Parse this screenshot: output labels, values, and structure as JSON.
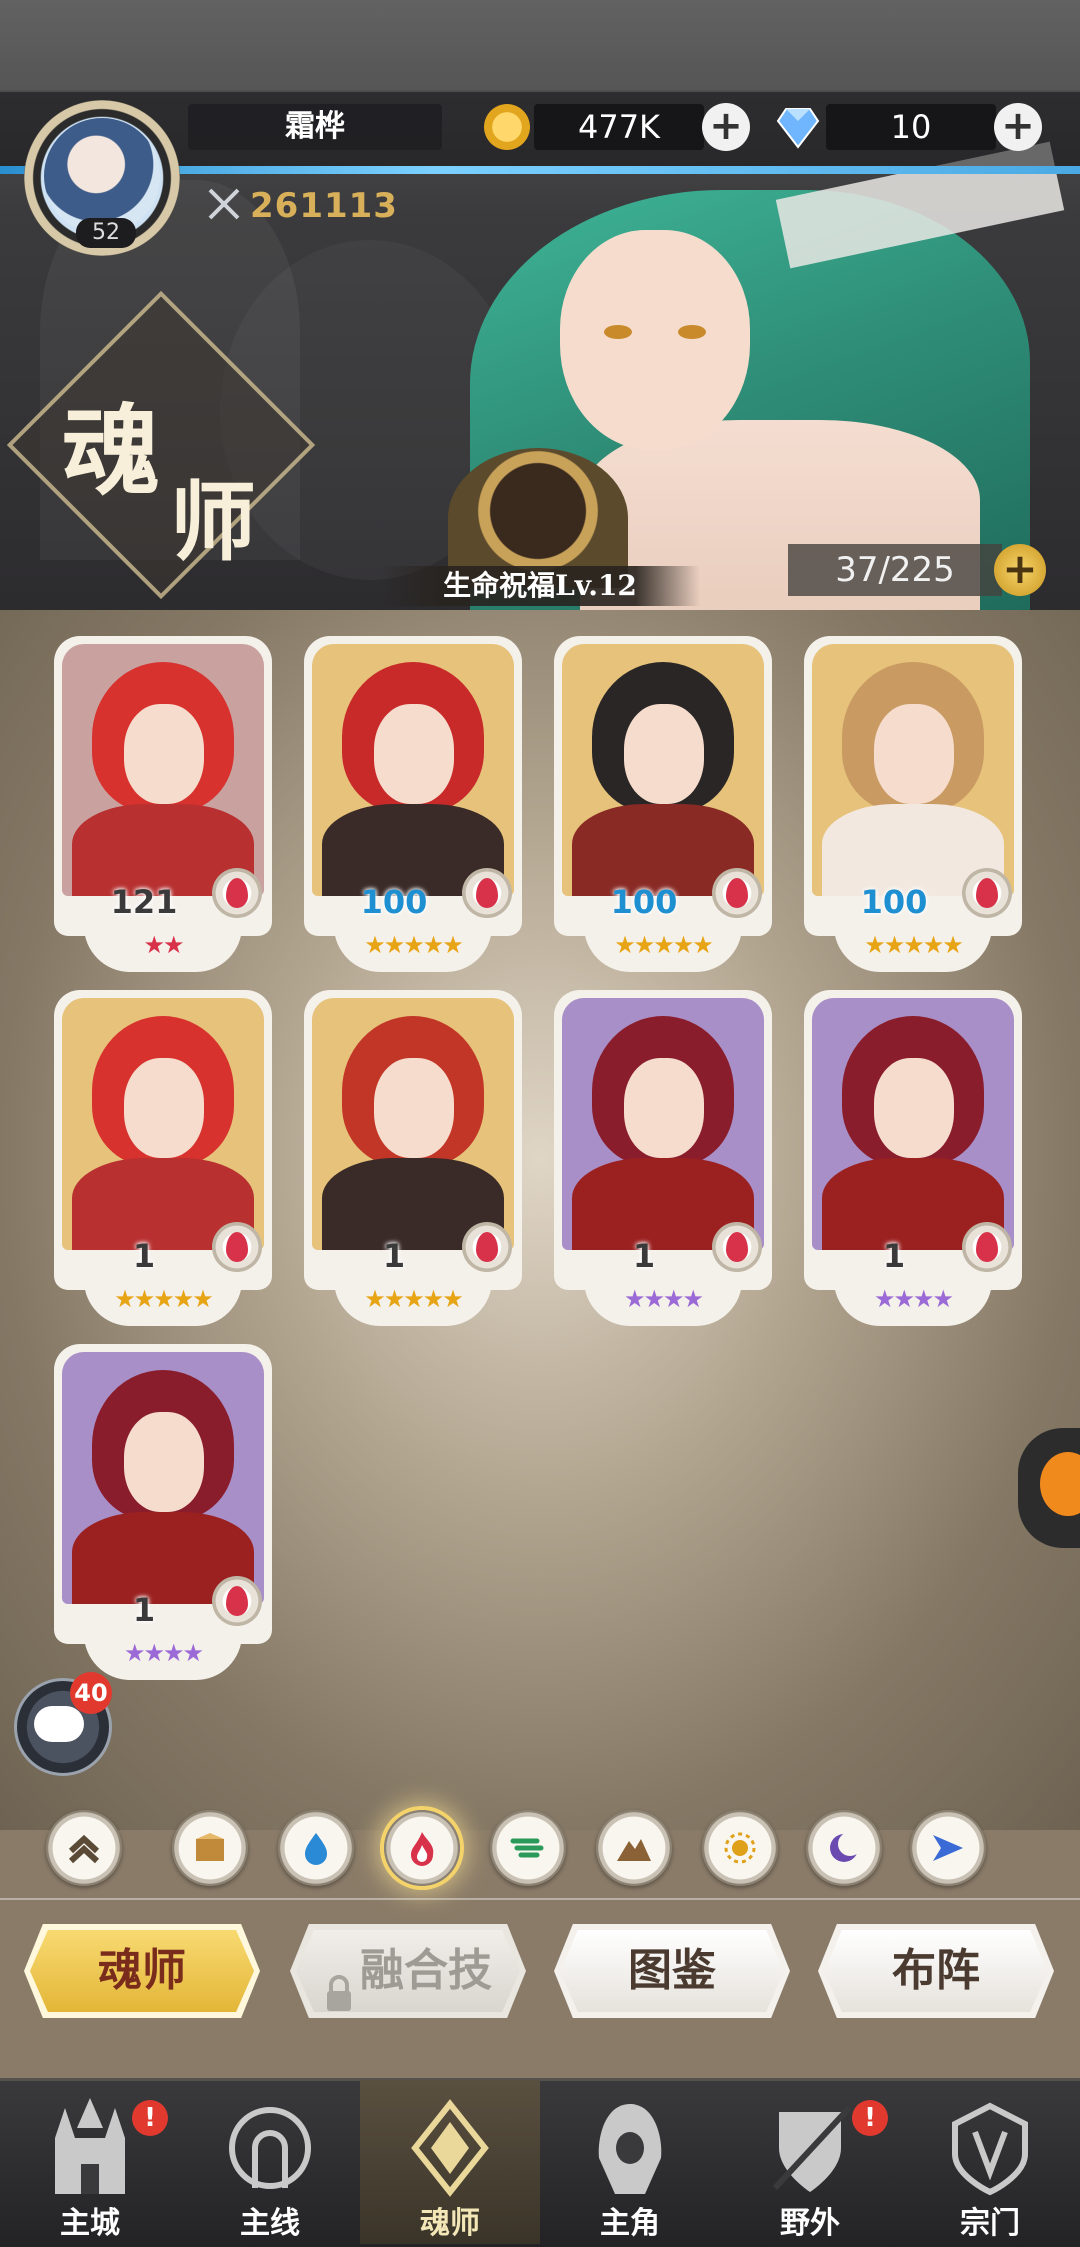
{
  "player": {
    "name": "霜桦",
    "level": "52",
    "power": "261113"
  },
  "resources": {
    "gold": "477K",
    "gems": "10"
  },
  "title": {
    "char1": "魂",
    "char2": "师"
  },
  "blessing": {
    "label": "生命祝福Lv.12"
  },
  "capacity": {
    "text": "37/225"
  },
  "cards": [
    {
      "level": "121",
      "stars": "★★",
      "star_color": "#d8324a",
      "lv_color": "#3a3a3a",
      "hair": "#d8322f",
      "body": "#b83030",
      "bg": "#c9a2a0",
      "stars_count": 2
    },
    {
      "level": "100",
      "stars": "★★★★★",
      "star_color": "#e7a516",
      "lv_color": "#1e8fd0",
      "hair": "#c82a2a",
      "body": "#3a2a28",
      "bg": "#e6c27a",
      "stars_count": 5
    },
    {
      "level": "100",
      "stars": "★★★★★",
      "star_color": "#e7a516",
      "lv_color": "#1e8fd0",
      "hair": "#2a2626",
      "body": "#8a2a25",
      "bg": "#e6c27a",
      "stars_count": 5
    },
    {
      "level": "100",
      "stars": "★★★★★",
      "star_color": "#e7a516",
      "lv_color": "#1e8fd0",
      "hair": "#c99a62",
      "body": "#f2e8df",
      "bg": "#e6c27a",
      "stars_count": 5
    },
    {
      "level": "1",
      "stars": "★★★★★",
      "star_color": "#e7a516",
      "lv_color": "#3a3a3a",
      "hair": "#d8322f",
      "body": "#b83030",
      "bg": "#e6c27a",
      "stars_count": 5
    },
    {
      "level": "1",
      "stars": "★★★★★",
      "star_color": "#e7a516",
      "lv_color": "#3a3a3a",
      "hair": "#c23628",
      "body": "#3a2a28",
      "bg": "#e6c27a",
      "stars_count": 5
    },
    {
      "level": "1",
      "stars": "★★★★",
      "star_color": "#9b6ad6",
      "lv_color": "#3a3a3a",
      "hair": "#8a1d2c",
      "body": "#9b2020",
      "bg": "#a98fc7",
      "stars_count": 4
    },
    {
      "level": "1",
      "stars": "★★★★",
      "star_color": "#9b6ad6",
      "lv_color": "#3a3a3a",
      "hair": "#8a1d2c",
      "body": "#9b2020",
      "bg": "#a98fc7",
      "stars_count": 4
    },
    {
      "level": "1",
      "stars": "★★★★",
      "star_color": "#9b6ad6",
      "lv_color": "#3a3a3a",
      "hair": "#8a1d2c",
      "body": "#9b2020",
      "bg": "#a98fc7",
      "stars_count": 4
    }
  ],
  "chat": {
    "badge": "40"
  },
  "filters": [
    {
      "name": "rank-filter",
      "icon": "chevron-up-icon",
      "color": "#5a4a36"
    },
    {
      "name": "box-filter",
      "icon": "box-icon",
      "color": "#c08a3a"
    },
    {
      "name": "water-filter",
      "icon": "water-drop-icon",
      "color": "#2a8ad6"
    },
    {
      "name": "fire-filter",
      "icon": "flame-icon",
      "color": "#d8324a",
      "active": true
    },
    {
      "name": "wind-filter",
      "icon": "wind-icon",
      "color": "#2a9a5a"
    },
    {
      "name": "earth-filter",
      "icon": "mountain-icon",
      "color": "#8a6236"
    },
    {
      "name": "light-filter",
      "icon": "sun-icon",
      "color": "#e0a11a"
    },
    {
      "name": "dark-filter",
      "icon": "moon-icon",
      "color": "#6a4ab0"
    },
    {
      "name": "special-filter",
      "icon": "arrow-shape-icon",
      "color": "#3a6ad6"
    }
  ],
  "tabs": [
    {
      "label": "魂师",
      "active": true
    },
    {
      "label": "融合技",
      "locked": true
    },
    {
      "label": "图鉴"
    },
    {
      "label": "布阵"
    }
  ],
  "nav": [
    {
      "label": "主城",
      "icon": "castle-icon",
      "badge": "!"
    },
    {
      "label": "主线",
      "icon": "portal-icon"
    },
    {
      "label": "魂师",
      "icon": "crystal-icon",
      "active": true
    },
    {
      "label": "主角",
      "icon": "hooded-figure-icon"
    },
    {
      "label": "野外",
      "icon": "shield-sword-icon",
      "badge": "!"
    },
    {
      "label": "宗门",
      "icon": "crest-icon"
    }
  ]
}
